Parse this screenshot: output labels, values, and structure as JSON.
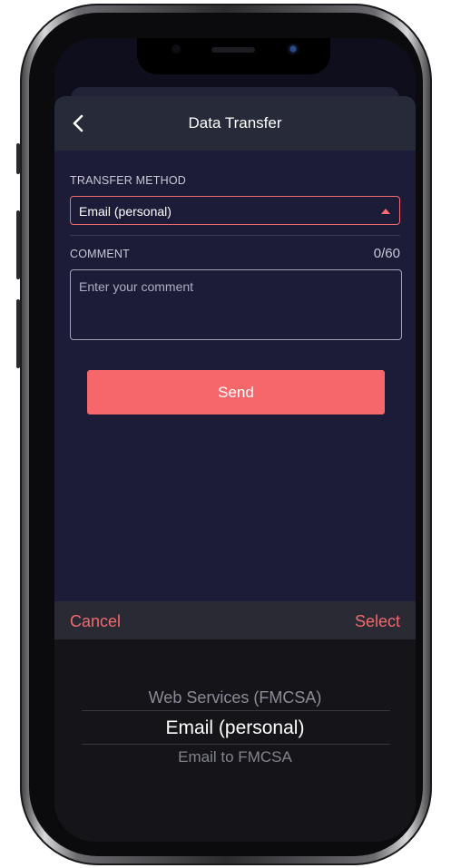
{
  "header": {
    "title": "Data Transfer",
    "back_icon": "chevron-left-icon"
  },
  "form": {
    "transfer_method_label": "TRANSFER METHOD",
    "transfer_method_value": "Email (personal)",
    "comment_label": "COMMENT",
    "comment_counter": "0/60",
    "comment_placeholder": "Enter your comment",
    "comment_value": "",
    "send_label": "Send"
  },
  "picker": {
    "cancel_label": "Cancel",
    "select_label": "Select",
    "options": [
      "Web Services (FMCSA)",
      "Email (personal)",
      "Email to FMCSA"
    ],
    "selected_index": 1
  },
  "colors": {
    "accent": "#f6676b",
    "background": "#1d1c38",
    "header": "#272a38",
    "picker_bg": "#141419"
  }
}
